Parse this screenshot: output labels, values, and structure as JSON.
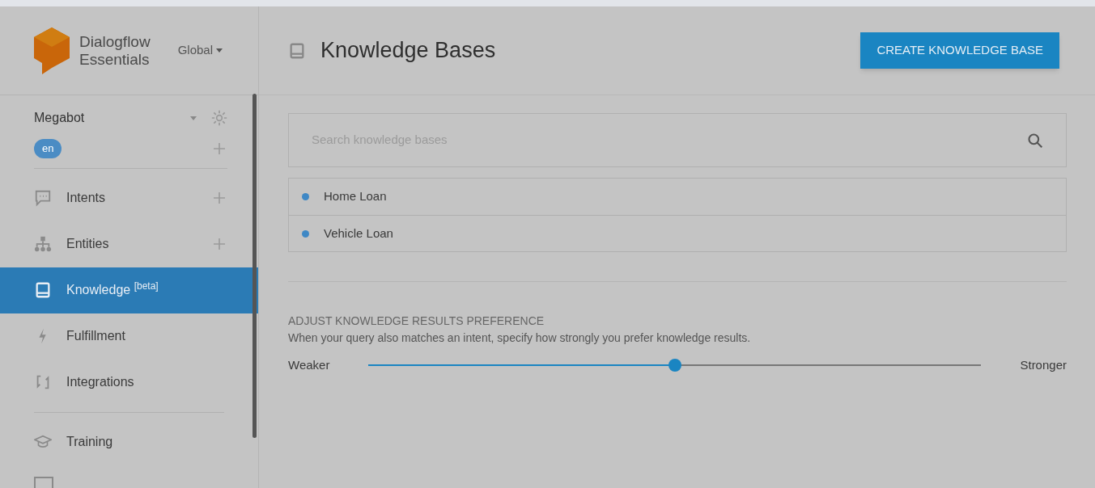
{
  "brand": {
    "line1": "Dialogflow",
    "line2": "Essentials",
    "region": "Global"
  },
  "agent": {
    "name": "Megabot",
    "language": "en"
  },
  "nav": [
    {
      "kind": "item",
      "label": "Intents",
      "add": true,
      "selected": false
    },
    {
      "kind": "item",
      "label": "Entities",
      "add": true,
      "selected": false
    },
    {
      "kind": "item",
      "label": "Knowledge $^{[beta]}$",
      "add": false,
      "selected": true
    },
    {
      "kind": "item",
      "label": "Fulfillment",
      "add": false,
      "selected": false
    },
    {
      "kind": "item",
      "label": "Integrations",
      "add": false,
      "selected": false
    },
    {
      "kind": "divider"
    },
    {
      "kind": "item",
      "label": "Training",
      "add": false,
      "selected": false
    }
  ],
  "page": {
    "title": "Knowledge Bases",
    "create_button": "CREATE KNOWLEDGE BASE"
  },
  "search": {
    "placeholder": "Search knowledge bases"
  },
  "knowledge_bases": [
    {
      "name": "Home Loan",
      "color": "#3f88c5"
    },
    {
      "name": "Vehicle Loan",
      "color": "#3f88c5"
    }
  ],
  "preference": {
    "heading": "ADJUST KNOWLEDGE RESULTS PREFERENCE",
    "description": "When your query also matches an intent, specify how strongly you prefer knowledge results.",
    "min_label": "Weaker",
    "max_label": "Stronger",
    "level": 0.5
  }
}
